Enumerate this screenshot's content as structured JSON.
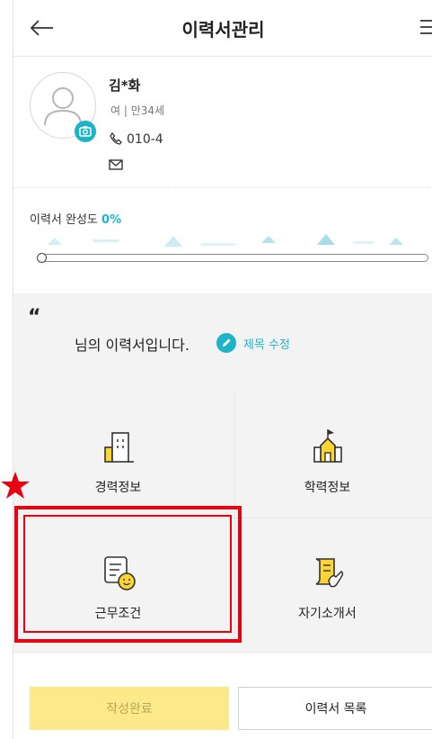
{
  "header": {
    "title": "이력서관리"
  },
  "profile": {
    "name": "김*화",
    "info": "여 | 만34세",
    "phone": "010-4"
  },
  "completion": {
    "label": "이력서 완성도",
    "value": "0%"
  },
  "resume": {
    "quote": "“",
    "title": "님의 이력서입니다.",
    "edit_label": "제목 수정"
  },
  "menu_grid": [
    {
      "label": "경력정보",
      "icon": "building-icon"
    },
    {
      "label": "학력정보",
      "icon": "school-icon"
    },
    {
      "label": "근무조건",
      "icon": "document-smile-icon"
    },
    {
      "label": "자기소개서",
      "icon": "hand-writing-icon"
    }
  ],
  "buttons": {
    "done": "작성완료",
    "list": "이력서 목록"
  },
  "colors": {
    "accent": "#1fb3c8",
    "yellow": "#fcd535",
    "annotation": "#e60012"
  }
}
